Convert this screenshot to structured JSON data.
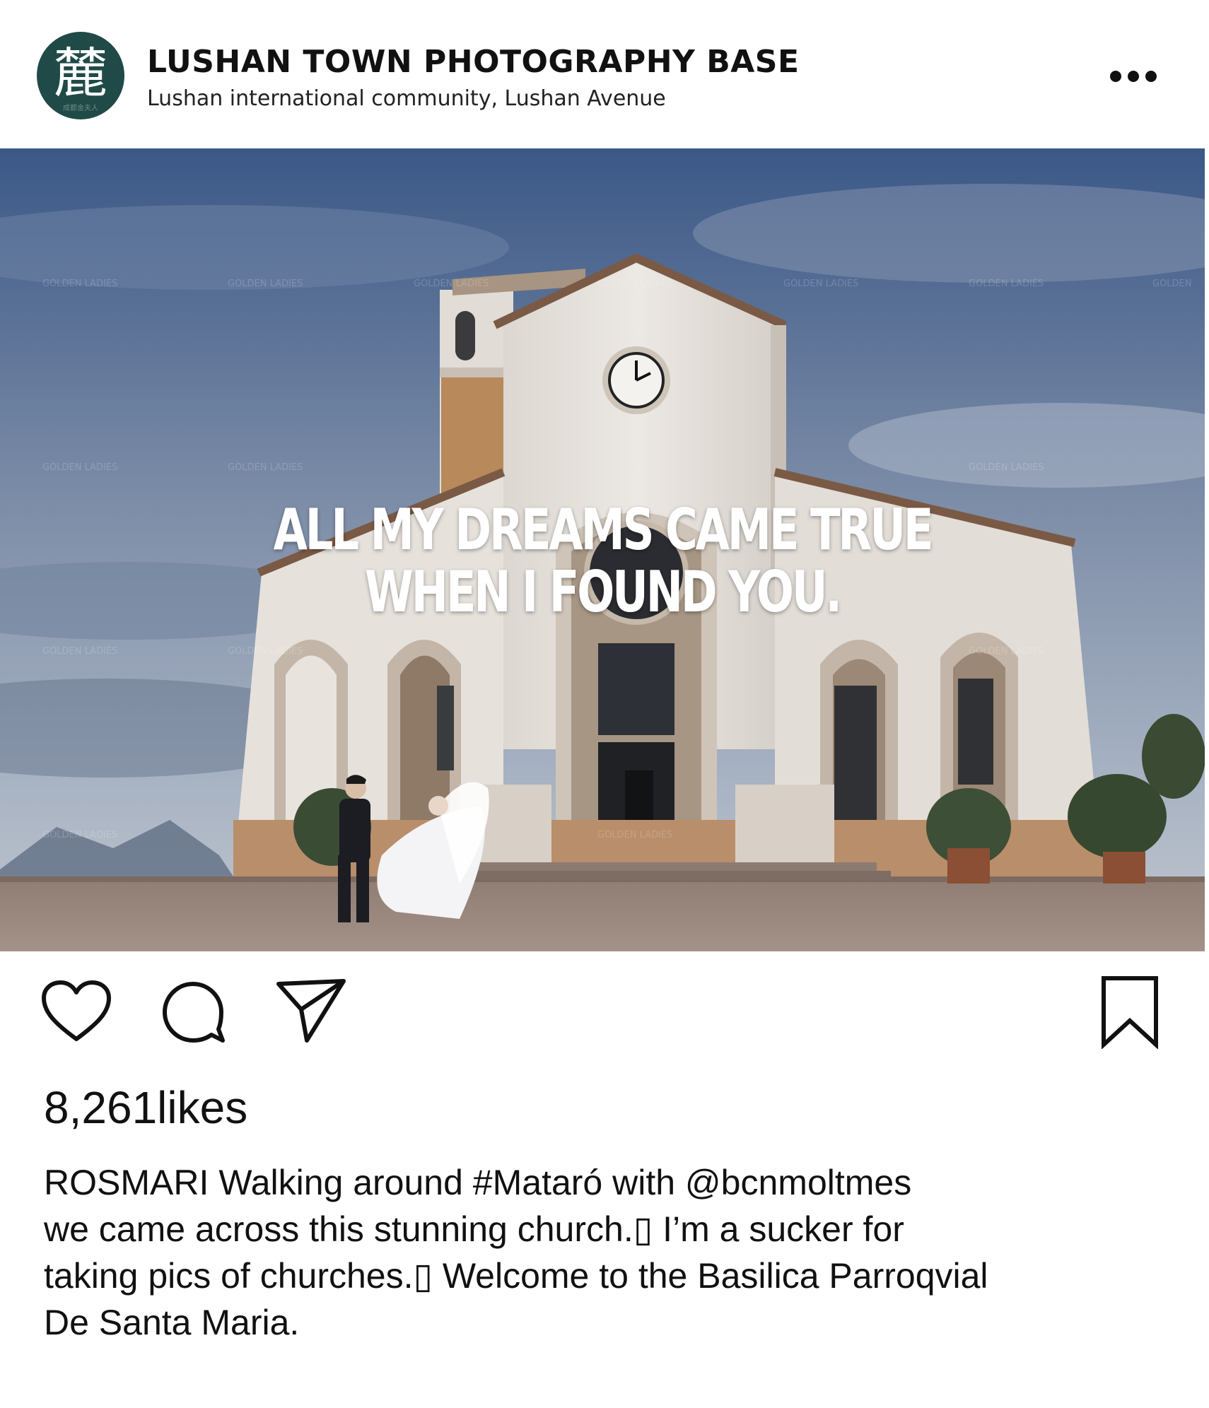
{
  "post": {
    "account_name": "LUSHAN TOWN PHOTOGRAPHY BASE",
    "location": "Lushan international community, Lushan Avenue",
    "avatar_glyph": "麓",
    "avatar_caption": "成都金夫人",
    "more_icon": "more-dots-icon",
    "image_overlay_lines": [
      "ALL MY DREAMS CAME TRUE",
      "WHEN I FOUND YOU."
    ],
    "watermark_text": "GOLDEN LADIES",
    "watermark_cn": "成都金夫人"
  },
  "actions": {
    "like_icon": "heart-icon",
    "comment_icon": "speech-bubble-icon",
    "share_icon": "paper-plane-icon",
    "save_icon": "bookmark-icon"
  },
  "likes": {
    "count": "8,261",
    "unit": "likes"
  },
  "caption": {
    "username": "ROSMARI",
    "lines": [
      "Walking around #Mataró with @bcnmoltmes",
      "we came across this stunning church.▯ I’m a sucker for",
      "taking pics of churches.▯ Welcome to the Basilica Parroqvial",
      "De Santa Maria."
    ]
  },
  "colors": {
    "avatar_bg": "#1f4a47",
    "sky_top": "#3c5a86",
    "sky_bottom": "#a7b3c4",
    "church_wall": "#e9e4de",
    "text": "#111111"
  }
}
